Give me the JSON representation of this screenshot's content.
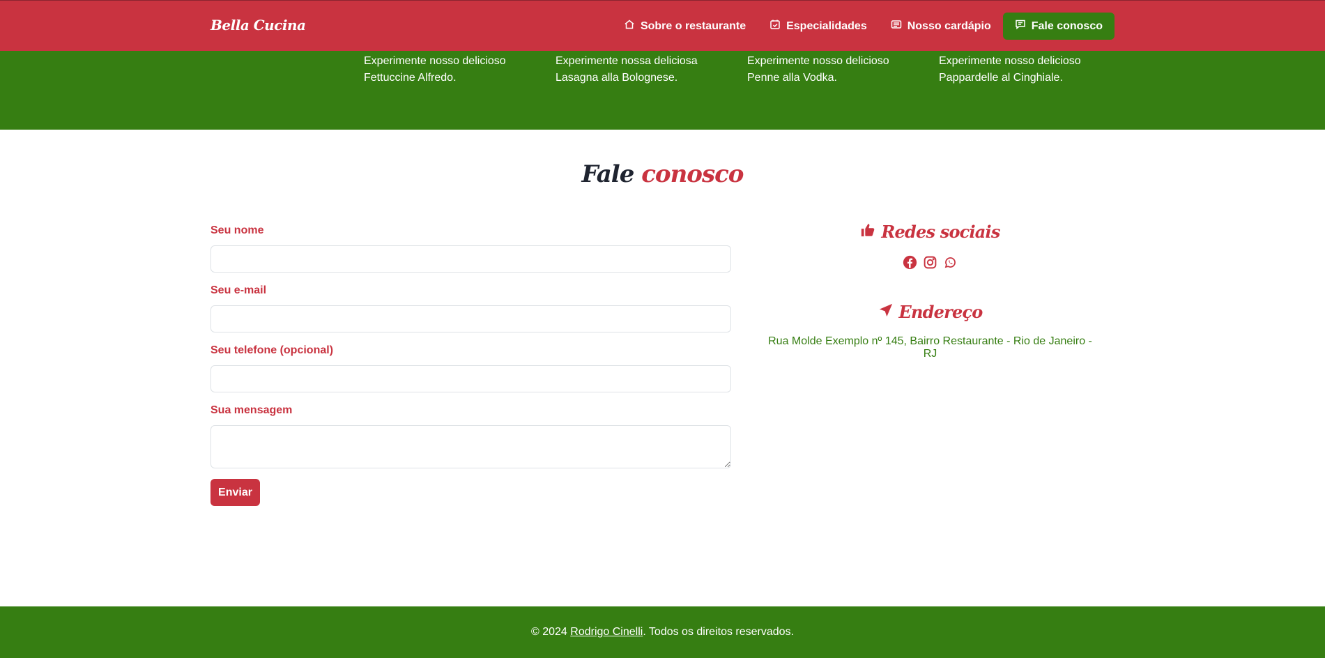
{
  "brand": "Bella Cucina",
  "nav": [
    {
      "label": "Sobre o restaurante",
      "icon": "home-icon"
    },
    {
      "label": "Especialidades",
      "icon": "calendar-check-icon"
    },
    {
      "label": "Nosso cardápio",
      "icon": "newspaper-icon"
    },
    {
      "label": "Fale conosco",
      "icon": "chat-icon",
      "active": true
    }
  ],
  "specialties": [
    "Experimente nosso delicioso Fettuccine Alfredo.",
    "Experimente nossa deliciosa Lasagna alla Bolognese.",
    "Experimente nosso delicioso Penne alla Vodka.",
    "Experimente nosso delicioso Pappardelle al Cinghiale."
  ],
  "contact": {
    "title_part1": "Fale",
    "title_part2": "conosco",
    "fields": [
      {
        "label": "Seu nome",
        "value": ""
      },
      {
        "label": "Seu e-mail",
        "value": ""
      },
      {
        "label": "Seu telefone (opcional)",
        "value": ""
      },
      {
        "label": "Sua mensagem",
        "value": ""
      }
    ],
    "submit_label": "Enviar"
  },
  "social": {
    "title": "Redes sociais",
    "icons": [
      "facebook-icon",
      "instagram-icon",
      "whatsapp-icon"
    ]
  },
  "address": {
    "title": "Endereço",
    "text": "Rua Molde Exemplo nº 145, Bairro Restaurante - Rio de Janeiro - RJ"
  },
  "footer": {
    "prefix": "© 2024 ",
    "author": "Rodrigo Cinelli",
    "suffix": ". Todos os direitos reservados."
  },
  "colors": {
    "primary_red": "#c93340",
    "primary_green": "#367e12",
    "heading_dark": "#1f2430"
  }
}
